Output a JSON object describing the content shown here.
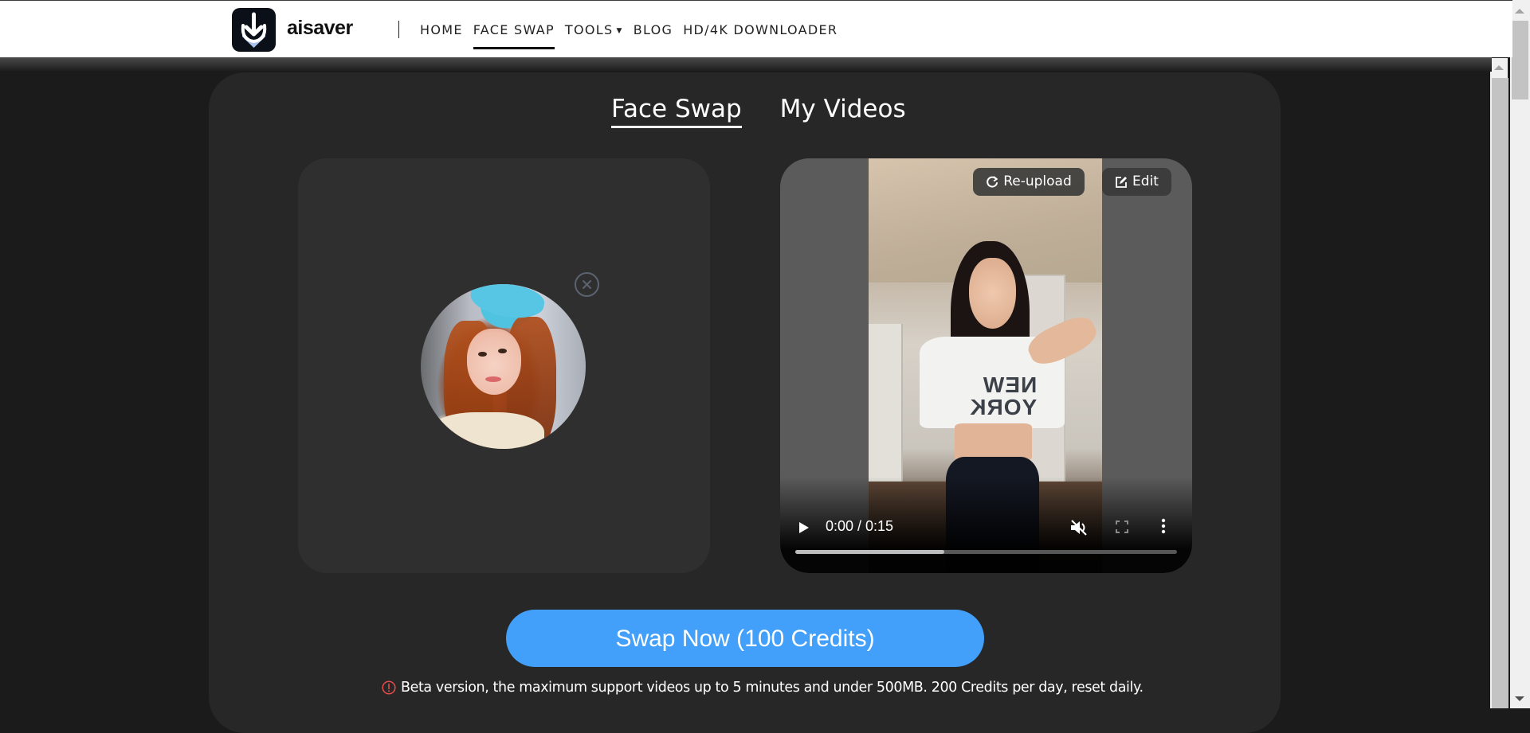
{
  "header": {
    "brand": "aisaver",
    "nav": [
      {
        "label": "HOME",
        "active": false
      },
      {
        "label": "FACE SWAP",
        "active": true
      },
      {
        "label": "TOOLS",
        "active": false,
        "has_dropdown": true
      },
      {
        "label": "BLOG",
        "active": false
      },
      {
        "label": "HD/4K DOWNLOADER",
        "active": false
      }
    ]
  },
  "tabs": [
    {
      "label": "Face Swap",
      "active": true
    },
    {
      "label": "My Videos",
      "active": false
    }
  ],
  "face_panel": {
    "close_icon": "close-circle-icon"
  },
  "video_panel": {
    "reupload_label": "Re-upload",
    "edit_label": "Edit",
    "player": {
      "time_display": "0:00 / 0:15",
      "buffered_fraction": 0.39,
      "muted": true
    },
    "shirt_text": "NEW YORK"
  },
  "actions": {
    "swap_label": "Swap Now (100 Credits)"
  },
  "notice": {
    "text": "Beta version, the maximum support videos up to 5 minutes and under 500MB. 200 Credits per day, reset daily."
  },
  "colors": {
    "accent": "#42a0fa",
    "page_bg": "#1b1b1b",
    "card_bg": "#272727",
    "panel_bg": "#2f2f2f",
    "warning": "#e74c4c"
  }
}
